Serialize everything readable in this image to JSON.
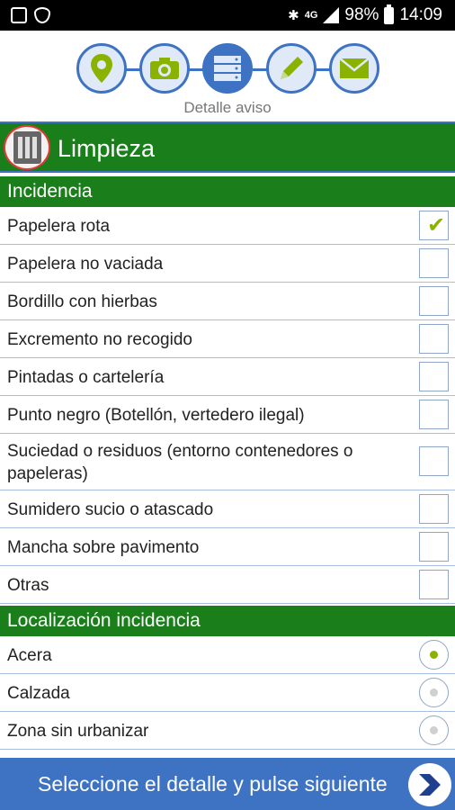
{
  "status_bar": {
    "network": "4G",
    "battery": "98%",
    "time": "14:09"
  },
  "steps": {
    "caption": "Detalle aviso",
    "items": [
      {
        "icon": "location-pin-icon"
      },
      {
        "icon": "camera-icon"
      },
      {
        "icon": "list-icon",
        "active": true
      },
      {
        "icon": "pencil-icon"
      },
      {
        "icon": "envelope-icon"
      }
    ]
  },
  "category": {
    "title": "Limpieza",
    "icon": "container-icon"
  },
  "incidencia": {
    "header": "Incidencia",
    "items": [
      {
        "label": "Papelera rota",
        "checked": true
      },
      {
        "label": "Papelera no vaciada",
        "checked": false
      },
      {
        "label": "Bordillo con hierbas",
        "checked": false
      },
      {
        "label": "Excremento no recogido",
        "checked": false
      },
      {
        "label": "Pintadas o cartelería",
        "checked": false
      },
      {
        "label": "Punto negro (Botellón, vertedero ilegal)",
        "checked": false
      },
      {
        "label": "Suciedad o residuos (entorno contenedores o papeleras)",
        "checked": false
      },
      {
        "label": "Sumidero sucio o atascado",
        "checked": false
      },
      {
        "label": "Mancha sobre pavimento",
        "checked": false
      },
      {
        "label": "Otras",
        "checked": false
      }
    ]
  },
  "localizacion": {
    "header": "Localización incidencia",
    "options": [
      {
        "label": "Acera",
        "selected": true
      },
      {
        "label": "Calzada",
        "selected": false
      },
      {
        "label": "Zona sin urbanizar",
        "selected": false
      }
    ]
  },
  "footer": {
    "text": "Seleccione el detalle y pulse siguiente",
    "next_icon": "chevron-right-icon"
  },
  "colors": {
    "green": "#1a7f1a",
    "blue": "#3e73c3",
    "check": "#8ab200"
  }
}
